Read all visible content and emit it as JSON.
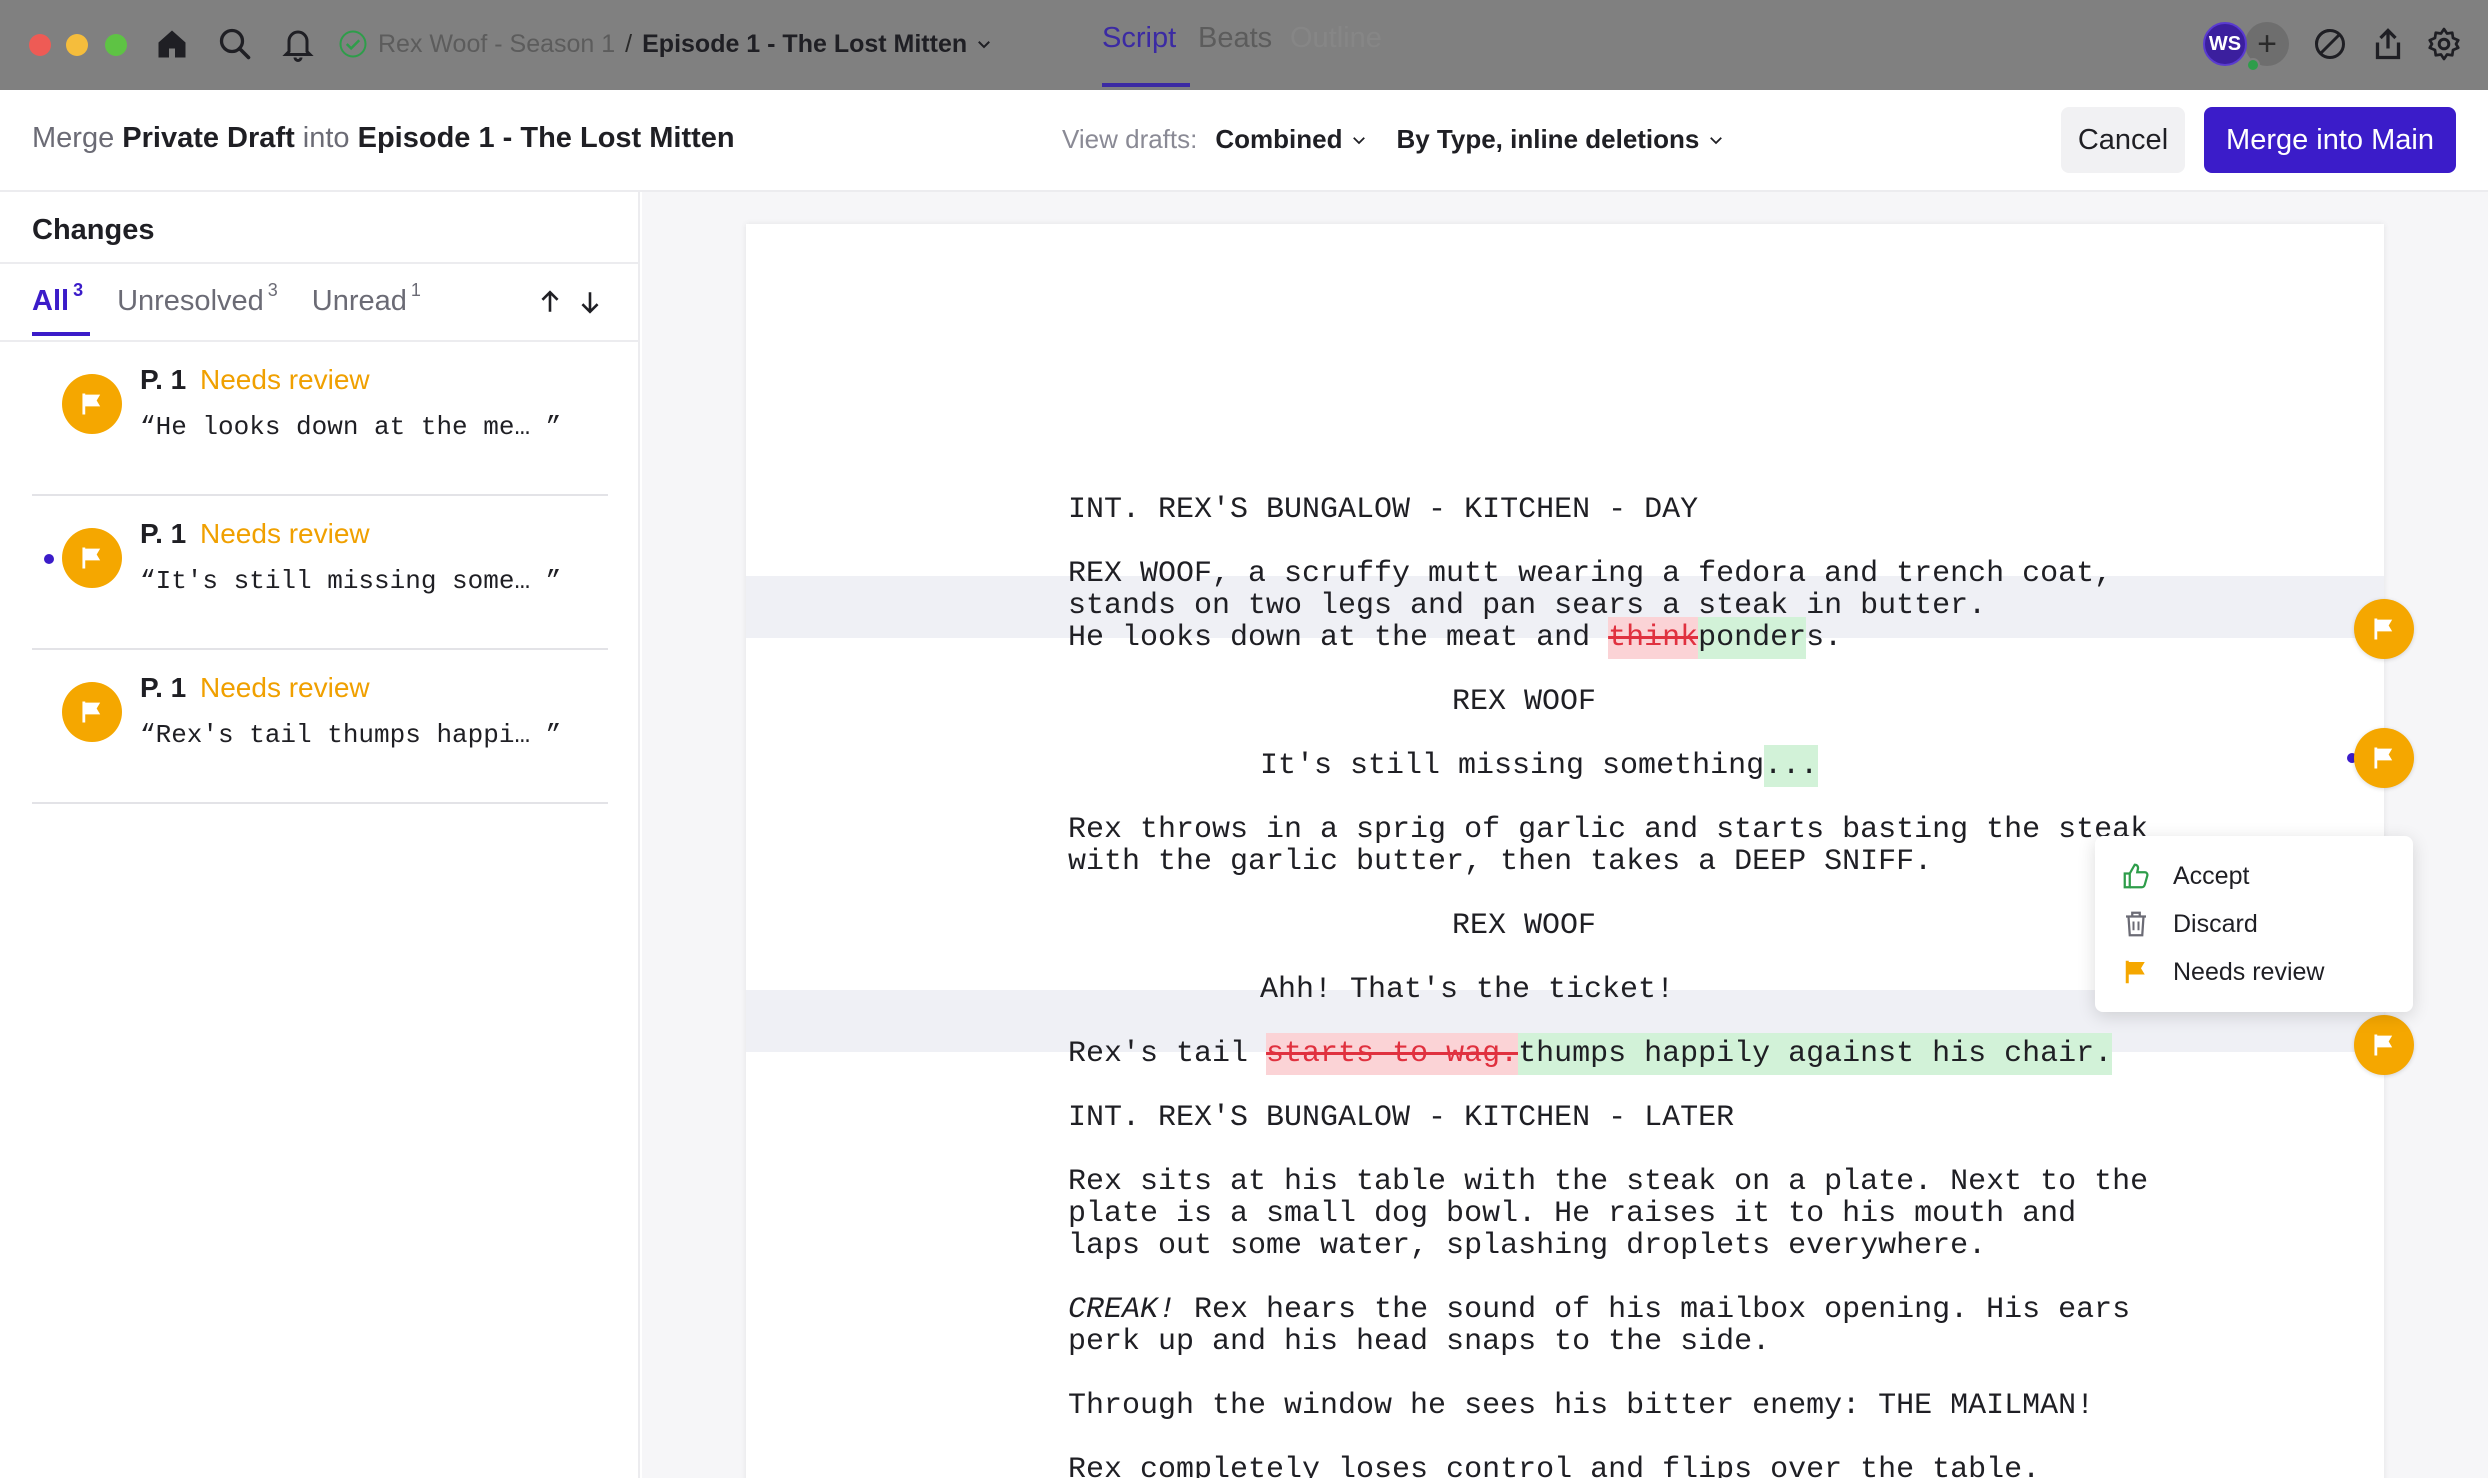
{
  "titlebar": {
    "breadcrumb": {
      "parent": "Rex Woof - Season 1",
      "separator": "/",
      "current": "Episode 1 - The Lost Mitten"
    },
    "mode_tabs": [
      "Script",
      "Beats",
      "Outline"
    ],
    "active_mode": "Script",
    "avatar_initials": "WS",
    "add_label": "+"
  },
  "merge_header": {
    "prefix": "Merge",
    "source": "Private Draft",
    "connector": "into",
    "target": "Episode 1 - The Lost Mitten",
    "view_drafts_label": "View drafts:",
    "view_mode": "Combined",
    "display_mode": "By Type, inline deletions",
    "cancel_label": "Cancel",
    "merge_label": "Merge into Main"
  },
  "sidebar": {
    "title": "Changes",
    "tabs": [
      {
        "label": "All",
        "count": "3"
      },
      {
        "label": "Unresolved",
        "count": "3"
      },
      {
        "label": "Unread",
        "count": "1"
      }
    ],
    "changes": [
      {
        "page": "P. 1",
        "status": "Needs review",
        "excerpt": "“He looks down at the me… ”",
        "unread": false
      },
      {
        "page": "P. 1",
        "status": "Needs review",
        "excerpt": "“It's still missing some… ”",
        "unread": true
      },
      {
        "page": "P. 1",
        "status": "Needs review",
        "excerpt": "“Rex's tail thumps happi… ”",
        "unread": false
      }
    ]
  },
  "script": {
    "scene1_heading": "INT. REX'S BUNGALOW - KITCHEN - DAY",
    "action1_line1": "REX WOOF, a scruffy mutt wearing a fedora and trench coat,",
    "action1_line2": "stands on two legs and pan sears a steak in butter.",
    "action2_before": "He looks down at the meat and ",
    "action2_deleted": "think",
    "action2_inserted": "ponder",
    "action2_after": "s.",
    "char1": "REX WOOF",
    "dialogue1_text": "It's still missing something",
    "dialogue1_inserted": "...",
    "action3_line1": "Rex throws in a sprig of garlic and starts basting the steak",
    "action3_line2": "with the garlic butter, then takes a DEEP SNIFF.",
    "char2": "REX WOOF",
    "dialogue2": "Ahh! That's the ticket!",
    "action4_before": "Rex's tail ",
    "action4_deleted": "starts to wag.",
    "action4_inserted": "thumps happily against his chair.",
    "scene2_heading": "INT. REX'S BUNGALOW - KITCHEN - LATER",
    "action5_line1": "Rex sits at his table with the steak on a plate. Next to the",
    "action5_line2": "plate is a small dog bowl. He raises it to his mouth and",
    "action5_line3": "laps out some water, splashing droplets everywhere.",
    "action6_italic": "CREAK!",
    "action6_line1_rest": " Rex hears the sound of his mailbox opening. His ears",
    "action6_line2": "perk up and his head snaps to the side.",
    "action7": "Through the window he sees his bitter enemy: THE MAILMAN!",
    "action8": "Rex completely loses control and flips over the table."
  },
  "context_menu": {
    "items": [
      "Accept",
      "Discard",
      "Needs review"
    ]
  },
  "colors": {
    "accent": "#3b1cc9",
    "review": "#f5a700",
    "deletion_bg": "#fbd3d6",
    "insertion_bg": "#d2f2d8"
  }
}
